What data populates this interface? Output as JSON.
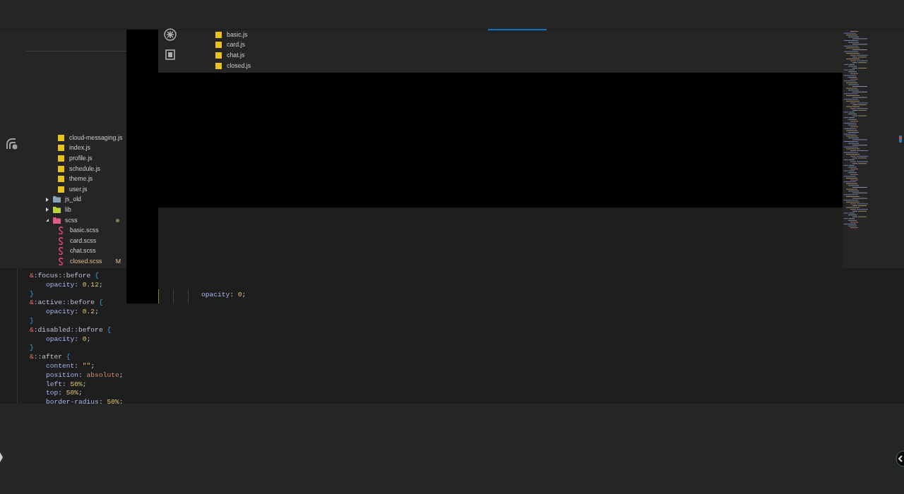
{
  "top_panel": {
    "files": [
      {
        "name": "basic.js",
        "kind": "js"
      },
      {
        "name": "card.js",
        "kind": "js"
      },
      {
        "name": "chat.js",
        "kind": "js"
      },
      {
        "name": "closed.js",
        "kind": "js"
      }
    ]
  },
  "explorer": {
    "items": [
      {
        "kind": "group",
        "children": [
          {
            "name": "cloud-messaging.js",
            "kind": "js"
          },
          {
            "name": "index.js",
            "kind": "js"
          },
          {
            "name": "profile.js",
            "kind": "js"
          },
          {
            "name": "schedule.js",
            "kind": "js"
          },
          {
            "name": "theme.js",
            "kind": "js"
          },
          {
            "name": "user.js",
            "kind": "js"
          }
        ]
      },
      {
        "name": "js_old",
        "kind": "folder",
        "color": "#8aa4b8",
        "expanded": false,
        "modified": false
      },
      {
        "name": "lib",
        "kind": "folder",
        "color": "#c0d23c",
        "expanded": false,
        "modified": false
      },
      {
        "name": "scss",
        "kind": "folder",
        "color": "#e05a8c",
        "expanded": true,
        "modified": true,
        "children": [
          {
            "name": "basic.scss",
            "kind": "scss",
            "modified": false
          },
          {
            "name": "card.scss",
            "kind": "scss",
            "modified": false
          },
          {
            "name": "chat.scss",
            "kind": "scss",
            "modified": false
          },
          {
            "name": "closed.scss",
            "kind": "scss",
            "modified": true,
            "badge": "M"
          }
        ]
      }
    ]
  },
  "editor": {
    "lines": [
      [
        {
          "t": "&",
          "kind": "amp"
        },
        {
          "t": ":focus::before",
          "kind": "sel"
        },
        {
          "t": " {",
          "kind": "brace"
        }
      ],
      [
        {
          "t": "    opacity",
          "kind": "prop"
        },
        {
          "t": ": ",
          "kind": "punct"
        },
        {
          "t": "0.12",
          "kind": "num"
        },
        {
          "t": ";",
          "kind": "punct"
        }
      ],
      [
        {
          "t": "}",
          "kind": "brace"
        }
      ],
      [
        {
          "t": "&",
          "kind": "amp"
        },
        {
          "t": ":active::before",
          "kind": "sel"
        },
        {
          "t": " {",
          "kind": "brace"
        }
      ],
      [
        {
          "t": "    opacity",
          "kind": "prop"
        },
        {
          "t": ": ",
          "kind": "punct"
        },
        {
          "t": "0.2",
          "kind": "num"
        },
        {
          "t": ";",
          "kind": "punct"
        }
      ],
      [
        {
          "t": "}",
          "kind": "brace"
        }
      ],
      [
        {
          "t": "&",
          "kind": "amp"
        },
        {
          "t": ":disabled::before",
          "kind": "sel"
        },
        {
          "t": " {",
          "kind": "brace"
        }
      ],
      [
        {
          "t": "    opacity",
          "kind": "prop"
        },
        {
          "t": ": ",
          "kind": "punct"
        },
        {
          "t": "0",
          "kind": "num"
        },
        {
          "t": ";",
          "kind": "punct"
        }
      ],
      [
        {
          "t": "}",
          "kind": "brace"
        }
      ],
      [
        {
          "t": "&",
          "kind": "amp"
        },
        {
          "t": "::after",
          "kind": "sel"
        },
        {
          "t": " {",
          "kind": "brace"
        }
      ],
      [
        {
          "t": "    content",
          "kind": "prop"
        },
        {
          "t": ": ",
          "kind": "punct"
        },
        {
          "t": "\"\"",
          "kind": "str"
        },
        {
          "t": ";",
          "kind": "punct"
        }
      ],
      [
        {
          "t": "    position",
          "kind": "prop"
        },
        {
          "t": ": ",
          "kind": "punct"
        },
        {
          "t": "absolute",
          "kind": "word"
        },
        {
          "t": ";",
          "kind": "punct"
        }
      ],
      [
        {
          "t": "    left",
          "kind": "prop"
        },
        {
          "t": ": ",
          "kind": "punct"
        },
        {
          "t": "50%",
          "kind": "num"
        },
        {
          "t": ";",
          "kind": "punct"
        }
      ],
      [
        {
          "t": "    top",
          "kind": "prop"
        },
        {
          "t": ": ",
          "kind": "punct"
        },
        {
          "t": "50%",
          "kind": "num"
        },
        {
          "t": ";",
          "kind": "punct"
        }
      ],
      [
        {
          "t": "    border-radius",
          "kind": "prop"
        },
        {
          "t": ": ",
          "kind": "punct"
        },
        {
          "t": "50%",
          "kind": "num"
        },
        {
          "t": ":",
          "kind": "punct"
        }
      ]
    ]
  },
  "center_editor": {
    "lines": [
      [
        {
          "t": "opacity",
          "kind": "prop"
        },
        {
          "t": ": ",
          "kind": "punct"
        },
        {
          "t": "0",
          "kind": "num"
        },
        {
          "t": ";",
          "kind": "punct"
        }
      ]
    ]
  }
}
